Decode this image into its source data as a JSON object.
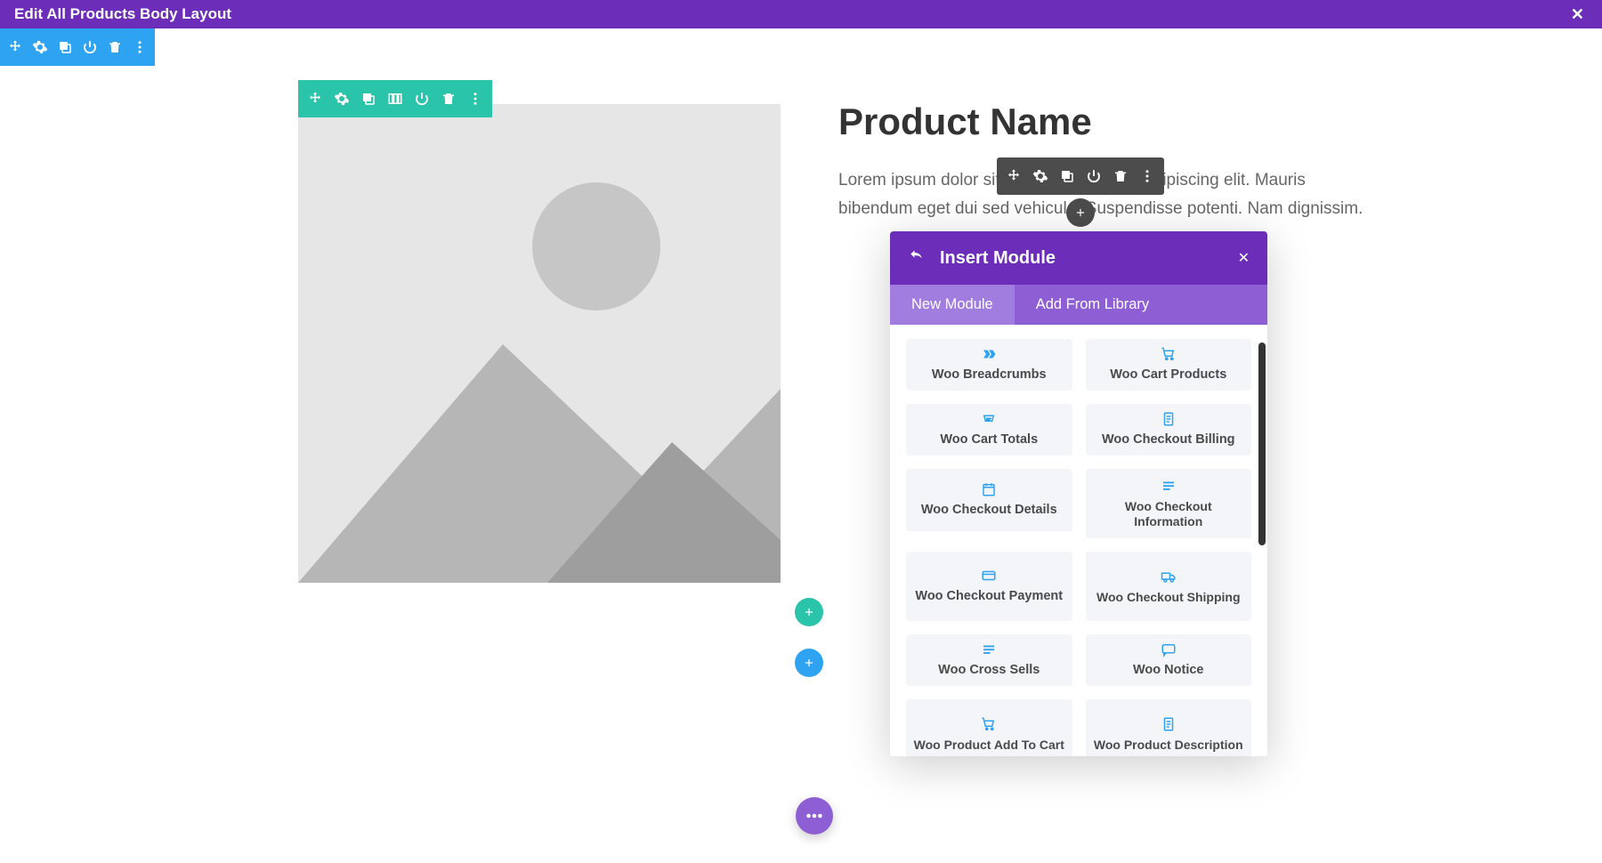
{
  "header": {
    "title": "Edit All Products Body Layout"
  },
  "product": {
    "name": "Product Name",
    "description": "Lorem ipsum dolor sit amet, consectetur adipiscing elit. Mauris bibendum eget dui sed vehicula. Suspendisse potenti. Nam dignissim."
  },
  "modal": {
    "title": "Insert Module",
    "tabs": {
      "new": "New Module",
      "library": "Add From Library"
    },
    "modules": [
      {
        "label": "Woo Breadcrumbs",
        "icon": "breadcrumbs"
      },
      {
        "label": "Woo Cart Products",
        "icon": "cart"
      },
      {
        "label": "Woo Cart Totals",
        "icon": "cart-totals"
      },
      {
        "label": "Woo Checkout Billing",
        "icon": "document"
      },
      {
        "label": "Woo Checkout Details",
        "icon": "calendar"
      },
      {
        "label": "Woo Checkout Information",
        "icon": "lines"
      },
      {
        "label": "Woo Checkout Payment",
        "icon": "credit-card"
      },
      {
        "label": "Woo Checkout Shipping",
        "icon": "truck"
      },
      {
        "label": "Woo Cross Sells",
        "icon": "lines"
      },
      {
        "label": "Woo Notice",
        "icon": "message"
      },
      {
        "label": "Woo Product Add To Cart",
        "icon": "cart"
      },
      {
        "label": "Woo Product Description",
        "icon": "document"
      }
    ]
  }
}
